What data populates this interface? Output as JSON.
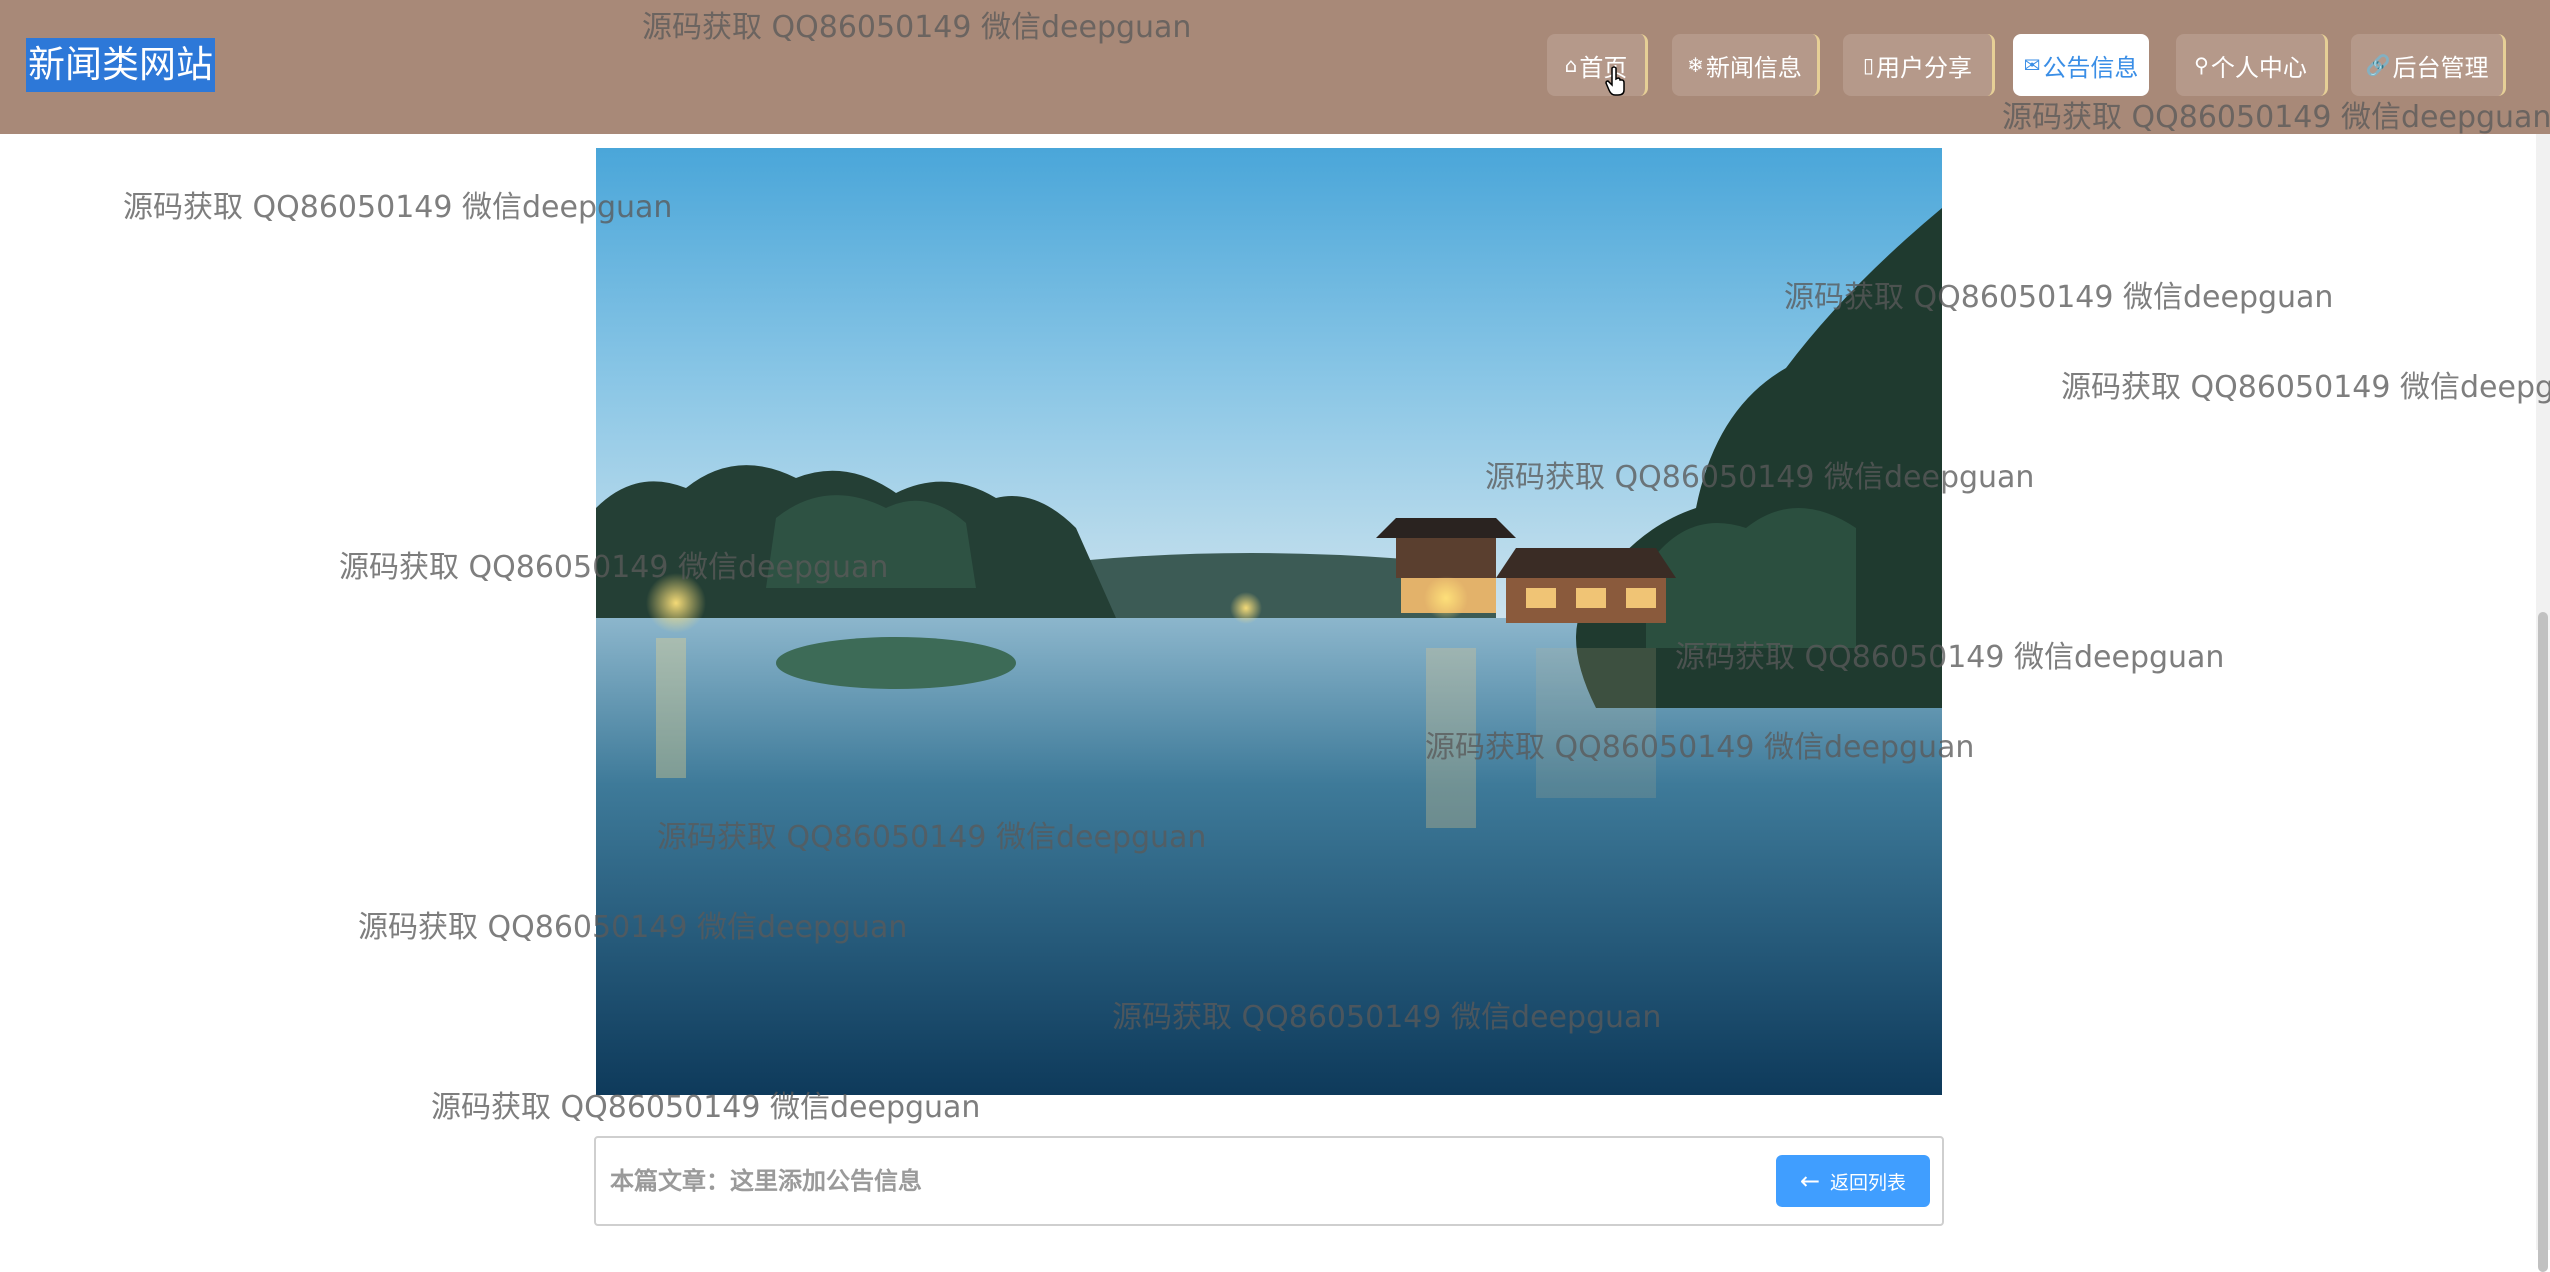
{
  "site": {
    "title": "新闻类网站"
  },
  "nav": {
    "items": [
      {
        "icon": "home-icon",
        "glyph": "⌂",
        "label": "首页",
        "active": false
      },
      {
        "icon": "snowflake-icon",
        "glyph": "❄",
        "label": "新闻信息",
        "active": false
      },
      {
        "icon": "document-icon",
        "glyph": "▯",
        "label": "用户分享",
        "active": false
      },
      {
        "icon": "mail-icon",
        "glyph": "✉",
        "label": "公告信息",
        "active": true
      },
      {
        "icon": "user-icon",
        "glyph": "⚲",
        "label": "个人中心",
        "active": false
      },
      {
        "icon": "link-icon",
        "glyph": "🔗",
        "label": "后台管理",
        "active": false
      }
    ]
  },
  "article": {
    "label": "本篇文章：这里添加公告信息",
    "back_label": "返回列表",
    "back_icon": "arrow-left-icon"
  },
  "watermark": {
    "text": "源码获取 QQ86050149 微信deepguan"
  },
  "colors": {
    "header_bg": "#a88978",
    "title_highlight": "#2d78d8",
    "active_nav_text": "#3a8ee6",
    "back_button": "#409eff"
  }
}
